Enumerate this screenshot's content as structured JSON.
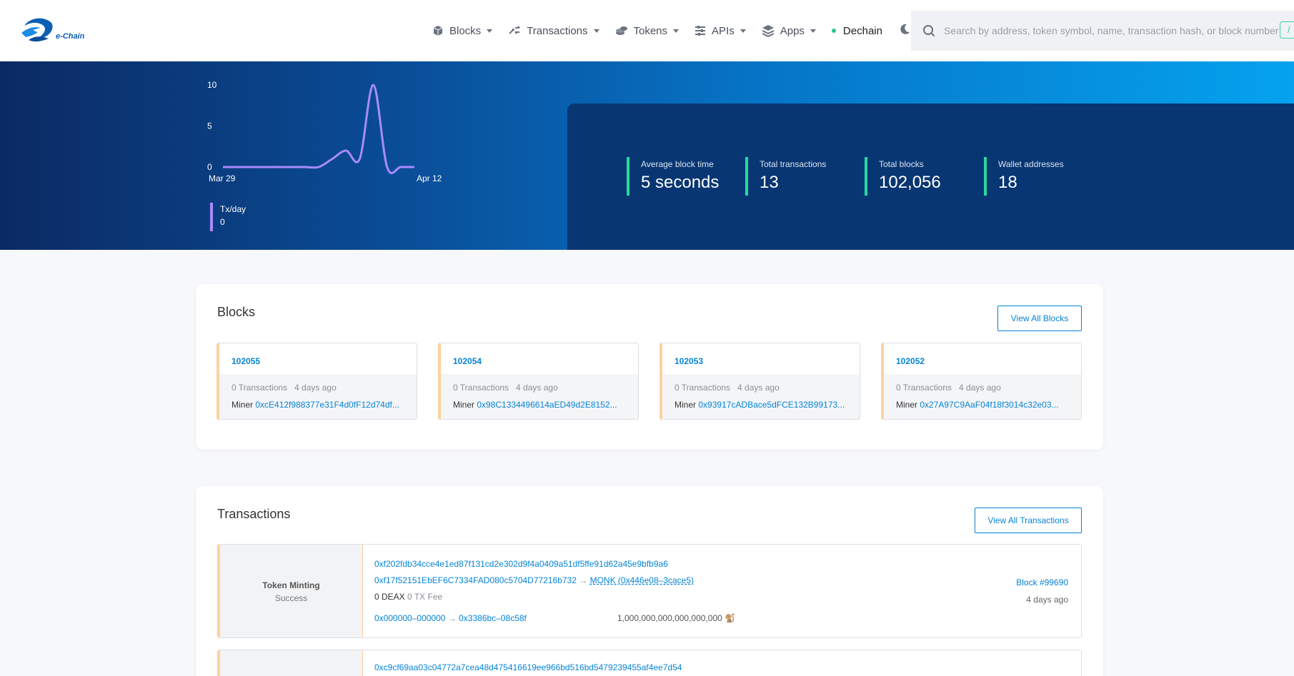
{
  "header": {
    "logo_text": "e-Chain",
    "nav": [
      {
        "label": "Blocks"
      },
      {
        "label": "Transactions"
      },
      {
        "label": "Tokens"
      },
      {
        "label": "APIs"
      },
      {
        "label": "Apps"
      }
    ],
    "network_label": "Dechain",
    "search_placeholder": "Search by address, token symbol, name, transaction hash, or block number",
    "search_shortcut": "/"
  },
  "hero": {
    "chart_data": {
      "type": "line",
      "x": [
        "Mar 29",
        "Apr 12"
      ],
      "y_ticks": [
        "0",
        "5",
        "10"
      ],
      "ylim": [
        0,
        10
      ],
      "x_tick_labels": [
        "Mar 29",
        "Apr 12"
      ],
      "series": [
        {
          "name": "Tx/day",
          "color": "#a78bfa",
          "values": [
            0,
            0,
            0,
            0,
            0,
            0,
            0,
            0,
            1,
            2,
            1,
            10,
            0,
            0,
            0
          ]
        }
      ]
    },
    "legend": {
      "label": "Tx/day",
      "value": "0"
    },
    "stats": [
      {
        "label": "Average block time",
        "value": "5 seconds"
      },
      {
        "label": "Total transactions",
        "value": "13"
      },
      {
        "label": "Total blocks",
        "value": "102,056"
      },
      {
        "label": "Wallet addresses",
        "value": "18"
      }
    ]
  },
  "blocks": {
    "title": "Blocks",
    "view_all": "View All Blocks",
    "items": [
      {
        "number": "102055",
        "tx": "0 Transactions",
        "ago": "4 days ago",
        "miner_label": "Miner",
        "miner": "0xcE412f988377e31F4d0fF12d74df..."
      },
      {
        "number": "102054",
        "tx": "0 Transactions",
        "ago": "4 days ago",
        "miner_label": "Miner",
        "miner": "0x98C1334496614aED49d2E8152..."
      },
      {
        "number": "102053",
        "tx": "0 Transactions",
        "ago": "4 days ago",
        "miner_label": "Miner",
        "miner": "0x93917cADBace5dFCE132B99173..."
      },
      {
        "number": "102052",
        "tx": "0 Transactions",
        "ago": "4 days ago",
        "miner_label": "Miner",
        "miner": "0x27A97C9AaF04f18f3014c32e03..."
      }
    ]
  },
  "transactions": {
    "title": "Transactions",
    "view_all": "View All Transactions",
    "items": [
      {
        "type": "Token Minting",
        "status": "Success",
        "hash": "0xf202fdb34cce4e1ed87f131cd2e302d9f4a0409a51df5ffe91d62a45e9bfb9a6",
        "from": "0xf17f52151EbEF6C7334FAD080c5704D77216b732",
        "arrow": "→",
        "to": "MONK (0x446e08–3cace5)",
        "amount": "0 DEAX",
        "fee": "0 TX Fee",
        "transfer_from": "0x000000–000000",
        "transfer_to": "0x3386bc–08c58f",
        "transfer_amount": "1,000,000,000,000,000,000",
        "token_emoji": "🐒",
        "block": "Block #99690",
        "ago": "4 days ago"
      },
      {
        "hash": "0xc9cf69aa03c04772a7cea48d475416619ee966bd516bd5479239455af4ee7d54"
      }
    ]
  }
}
